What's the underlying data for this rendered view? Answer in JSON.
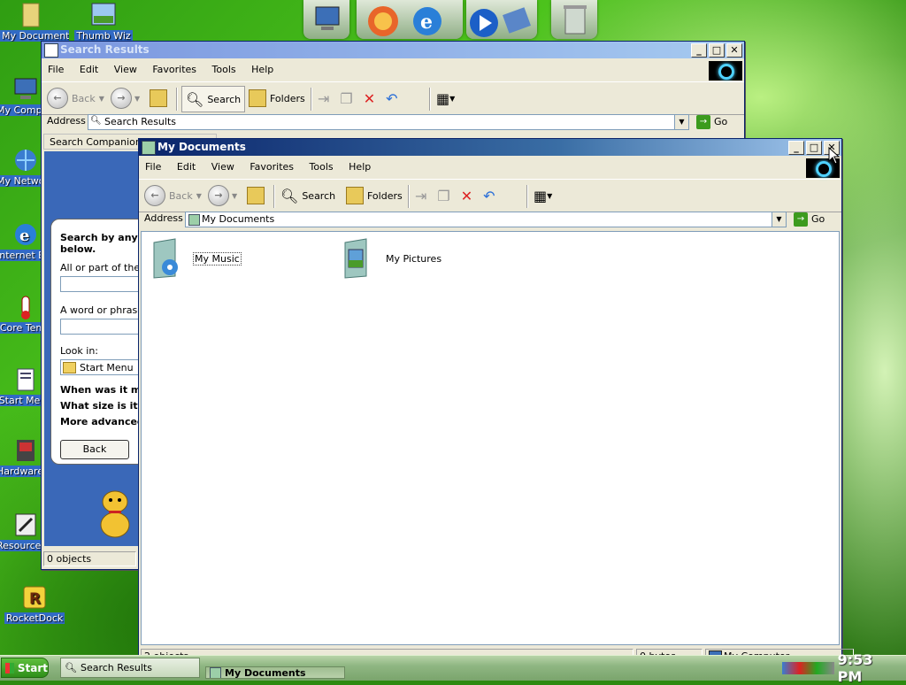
{
  "desktop": {
    "icons": [
      {
        "label": "My Documents",
        "icon": "folder-documents-icon"
      },
      {
        "label": "Thumb Wiz",
        "icon": "thumb-wiz-icon"
      },
      {
        "label": "My Computer",
        "icon": "computer-icon"
      },
      {
        "label": "My Network Places",
        "icon": "network-icon"
      },
      {
        "label": "Internet Explorer",
        "icon": "ie-icon"
      },
      {
        "label": "Core Temp",
        "icon": "core-temp-icon"
      },
      {
        "label": "Start Menu",
        "icon": "start-menu-icon"
      },
      {
        "label": "Hardware Monitor",
        "icon": "hardware-monitor-icon"
      },
      {
        "label": "Resource Hacker",
        "icon": "resource-hacker-icon"
      },
      {
        "label": "RocketDock",
        "icon": "rocketdock-icon"
      }
    ],
    "dock_items": [
      "computer-icon",
      "paint-icon",
      "firefox-icon",
      "ie-icon",
      "media-player-icon",
      "network-icon",
      "recycle-bin-icon"
    ]
  },
  "search_window": {
    "title": "Search Results",
    "menu": [
      "File",
      "Edit",
      "View",
      "Favorites",
      "Tools",
      "Help"
    ],
    "toolbar": {
      "back": "Back",
      "search": "Search",
      "folders": "Folders"
    },
    "address_label": "Address",
    "address_value": "Search Results",
    "go": "Go",
    "companion_title": "Search Companion",
    "companion": {
      "heading": "Search by any or all of the criteria below.",
      "name_label": "All or part of the file name:",
      "word_label": "A word or phrase in the file:",
      "lookin_label": "Look in:",
      "lookin_value": "Start Menu",
      "when": "When was it modified?",
      "size": "What size is it?",
      "advanced": "More advanced options",
      "back": "Back"
    },
    "status": "0 objects"
  },
  "docs_window": {
    "title": "My Documents",
    "menu": [
      "File",
      "Edit",
      "View",
      "Favorites",
      "Tools",
      "Help"
    ],
    "toolbar": {
      "back": "Back",
      "search": "Search",
      "folders": "Folders"
    },
    "address_label": "Address",
    "address_value": "My Documents",
    "go": "Go",
    "items": [
      {
        "label": "My Music",
        "icon": "music-folder-icon"
      },
      {
        "label": "My Pictures",
        "icon": "pictures-folder-icon"
      }
    ],
    "status": {
      "objects": "2 objects",
      "size": "0 bytes",
      "location": "My Computer"
    }
  },
  "taskbar": {
    "start": "Start",
    "buttons": [
      "Search Results",
      "My Documents"
    ],
    "clock": "9:53 PM"
  },
  "colors": {
    "titlebar_active": "#0a246a",
    "taskbar": "#8fb682",
    "desktop": "#2d8a10"
  }
}
